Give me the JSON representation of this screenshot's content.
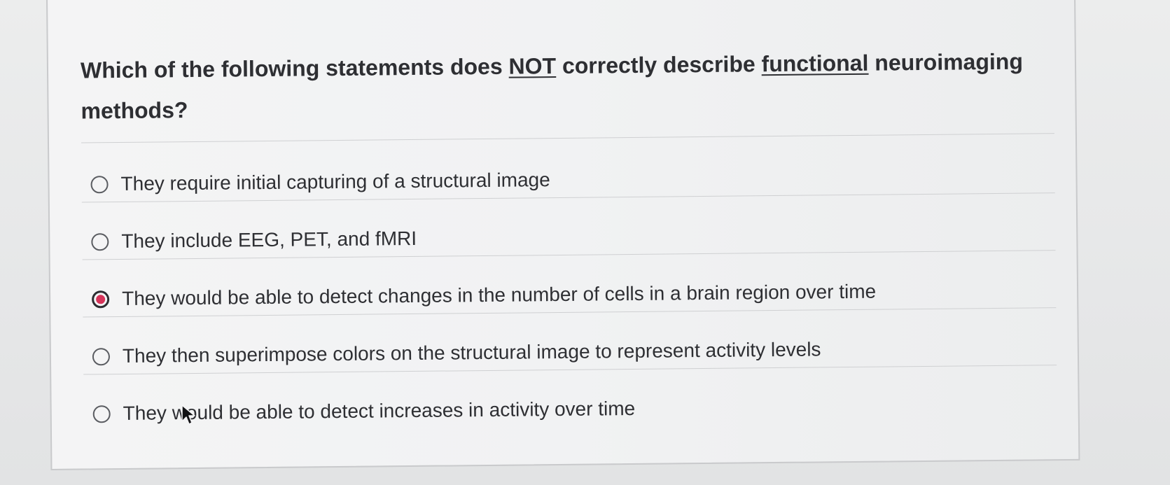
{
  "question": {
    "part1": "Which of the following statements does ",
    "emphasis_not": "NOT",
    "part2": " correctly describe ",
    "emphasis_functional": "functional",
    "part3": " neuroimaging methods?"
  },
  "options": [
    {
      "label": "They require initial capturing of a structural image",
      "selected": false
    },
    {
      "label": "They include EEG, PET, and fMRI",
      "selected": false
    },
    {
      "label": "They would be able to detect changes in the number of cells in a brain region over time",
      "selected": true
    },
    {
      "label": "They then superimpose colors on the structural image to represent activity levels",
      "selected": false
    },
    {
      "label": "They would be able to detect increases in activity over time",
      "selected": false
    }
  ],
  "colors": {
    "selected_radio": "#d6345a",
    "text": "#2e2f33",
    "background": "#e4e5e7"
  },
  "icons": {
    "cursor": "arrow-pointer-icon"
  }
}
